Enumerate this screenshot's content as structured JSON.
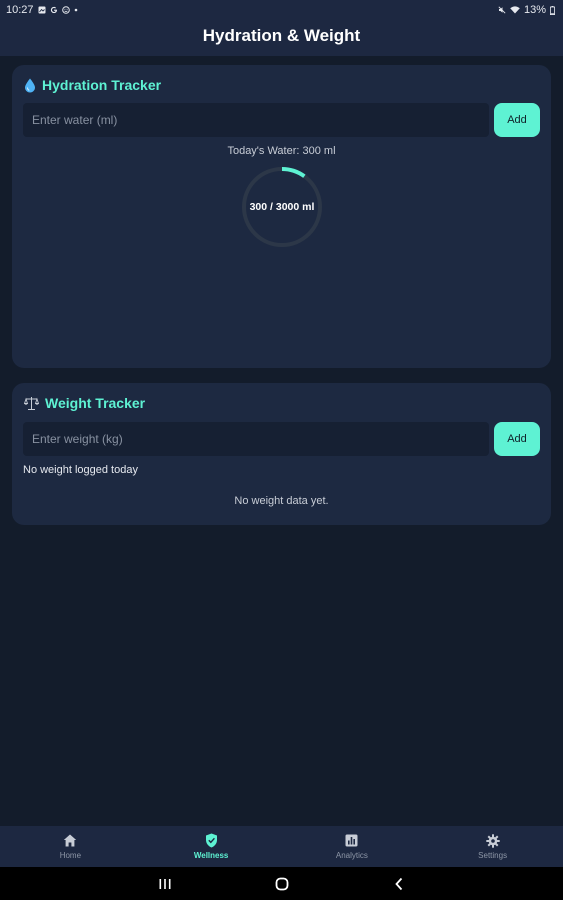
{
  "status_bar": {
    "time": "10:27",
    "battery": "13%"
  },
  "app_bar": {
    "title": "Hydration & Weight"
  },
  "hydration": {
    "title": "Hydration Tracker",
    "input_placeholder": "Enter water (ml)",
    "add_label": "Add",
    "today_text": "Today's Water: 300 ml",
    "ring_label": "300 / 3000 ml",
    "progress_fraction": 0.1,
    "accent_color": "#5ef2d3"
  },
  "weight": {
    "title": "Weight Tracker",
    "input_placeholder": "Enter weight (kg)",
    "add_label": "Add",
    "status_text": "No weight logged today",
    "empty_text": "No weight data yet."
  },
  "bottom_nav": {
    "items": [
      {
        "label": "Home",
        "icon": "home-icon"
      },
      {
        "label": "Wellness",
        "icon": "shield-icon",
        "active": true
      },
      {
        "label": "Analytics",
        "icon": "analytics-icon"
      },
      {
        "label": "Settings",
        "icon": "gear-icon"
      }
    ]
  }
}
